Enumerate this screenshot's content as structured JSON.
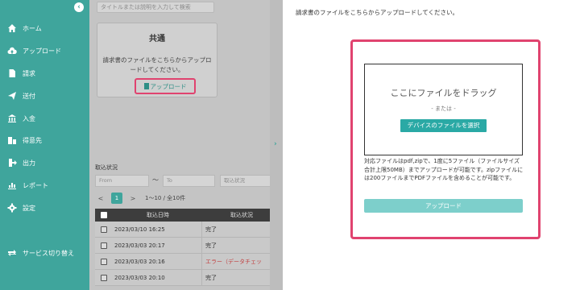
{
  "sidebar": {
    "toggle_icon": "arrow-left-icon",
    "items": [
      {
        "label": "ホーム",
        "icon": "home-icon"
      },
      {
        "label": "アップロード",
        "icon": "cloud-upload-icon"
      },
      {
        "label": "請求",
        "icon": "document-icon"
      },
      {
        "label": "送付",
        "icon": "send-icon"
      },
      {
        "label": "入金",
        "icon": "bank-icon"
      },
      {
        "label": "得意先",
        "icon": "building-icon"
      },
      {
        "label": "出力",
        "icon": "export-icon"
      },
      {
        "label": "レポート",
        "icon": "chart-icon"
      },
      {
        "label": "設定",
        "icon": "gear-icon"
      }
    ],
    "switch_service_label": "サービス切り替え",
    "switch_service_icon": "switch-icon"
  },
  "middle": {
    "search_placeholder": "タイトルまたは説明を入力して検索",
    "card": {
      "title": "共通",
      "description": "請求書のファイルをこちらからアップロードしてください。",
      "upload_label": "アップロード"
    },
    "history": {
      "section_label": "取込状況",
      "from_placeholder": "From",
      "tilde": "〜",
      "to_placeholder": "To",
      "status_placeholder": "取込状況",
      "pager": {
        "prev": "<",
        "current": "1",
        "next": ">",
        "info": "1〜10 / 全10件"
      },
      "headers": {
        "date": "取込日時",
        "status": "取込状況"
      },
      "rows": [
        {
          "date": "2023/03/10 16:25",
          "status": "完了",
          "error": false
        },
        {
          "date": "2023/03/03 20:17",
          "status": "完了",
          "error": false
        },
        {
          "date": "2023/03/03 20:16",
          "status": "エラー（データチェッ",
          "error": true
        },
        {
          "date": "2023/03/03 20:10",
          "status": "完了",
          "error": false
        }
      ]
    }
  },
  "divider_icon": "chevron-right-icon",
  "right": {
    "description": "請求書のファイルをこちらからアップロードしてください。",
    "dropzone": {
      "title": "ここにファイルをドラッグ",
      "or_text": "- または -",
      "select_button": "デバイスのファイルを選択",
      "note": "対応ファイルはpdf,zipで、1度に5ファイル（ファイルサイズ合計上限50MB）までアップロードが可能です。zipファイルには200ファイルまでPDFファイルを含めることが可能です。",
      "upload_button": "アップロード"
    }
  },
  "colors": {
    "accent": "#3fa59c",
    "highlight": "#e0436f",
    "upload_disabled": "#7dcfcb",
    "error": "#c24040"
  }
}
